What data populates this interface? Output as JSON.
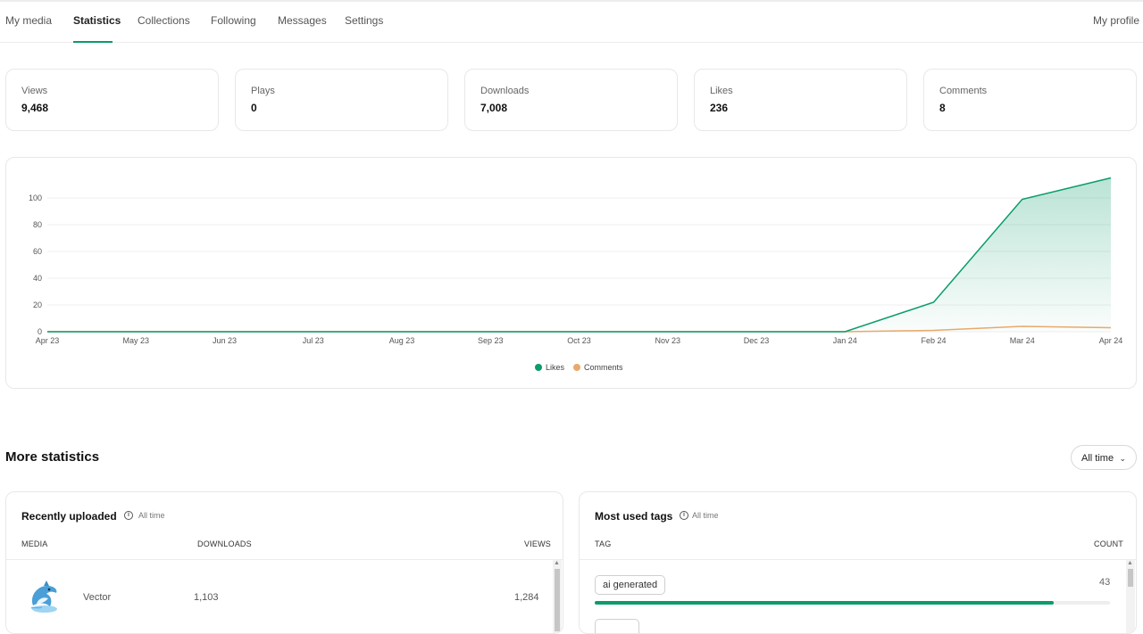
{
  "nav": {
    "items": [
      {
        "label": "My media",
        "active": false
      },
      {
        "label": "Statistics",
        "active": true
      },
      {
        "label": "Collections",
        "active": false
      },
      {
        "label": "Following",
        "active": false
      },
      {
        "label": "Messages",
        "active": false
      },
      {
        "label": "Settings",
        "active": false
      }
    ],
    "profile": "My profile"
  },
  "stats": [
    {
      "label": "Views",
      "value": "9,468"
    },
    {
      "label": "Plays",
      "value": "0"
    },
    {
      "label": "Downloads",
      "value": "7,008"
    },
    {
      "label": "Likes",
      "value": "236"
    },
    {
      "label": "Comments",
      "value": "8"
    }
  ],
  "chart_data": {
    "type": "area",
    "x": [
      "Apr 23",
      "May 23",
      "Jun 23",
      "Jul 23",
      "Aug 23",
      "Sep 23",
      "Oct 23",
      "Nov 23",
      "Dec 23",
      "Jan 24",
      "Feb 24",
      "Mar 24",
      "Apr 24"
    ],
    "yticks": [
      0,
      20,
      40,
      60,
      80,
      100
    ],
    "ylim": [
      0,
      120
    ],
    "series": [
      {
        "name": "Likes",
        "color": "#0a9c69",
        "fill": true,
        "values": [
          0,
          0,
          0,
          0,
          0,
          0,
          0,
          0,
          0,
          0,
          22,
          99,
          115
        ]
      },
      {
        "name": "Comments",
        "color": "#e8a96a",
        "fill": false,
        "values": [
          0,
          0,
          0,
          0,
          0,
          0,
          0,
          0,
          0,
          0,
          1,
          4,
          3
        ]
      }
    ],
    "grid": true,
    "legend": "bottom-center"
  },
  "more": {
    "title": "More statistics",
    "time_filter": "All time",
    "recent": {
      "title": "Recently uploaded",
      "subtitle": "All time",
      "columns": [
        "MEDIA",
        "DOWNLOADS",
        "VIEWS"
      ],
      "rows": [
        {
          "type": "Vector",
          "downloads": "1,103",
          "views": "1,284"
        }
      ]
    },
    "tags": {
      "title": "Most used tags",
      "subtitle": "All time",
      "columns": [
        "TAG",
        "COUNT"
      ],
      "rows": [
        {
          "tag": "ai generated",
          "count": "43",
          "fraction": 0.89
        }
      ]
    }
  }
}
